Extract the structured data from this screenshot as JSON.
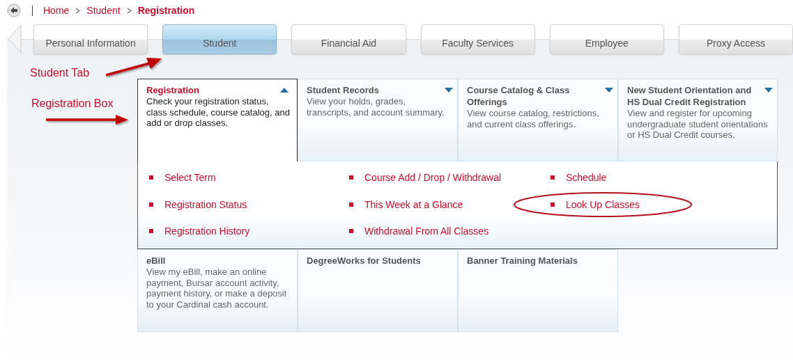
{
  "breadcrumb": [
    {
      "label": "Home",
      "current": false
    },
    {
      "label": "Student",
      "current": false
    },
    {
      "label": "Registration",
      "current": true
    }
  ],
  "tabs": [
    {
      "label": "Personal Information",
      "selected": false
    },
    {
      "label": "Student",
      "selected": true
    },
    {
      "label": "Financial Aid",
      "selected": false
    },
    {
      "label": "Faculty Services",
      "selected": false
    },
    {
      "label": "Employee",
      "selected": false
    },
    {
      "label": "Proxy Access",
      "selected": false
    }
  ],
  "annotations": [
    {
      "text": "Student Tab",
      "kind": "tab"
    },
    {
      "text": "Registration Box",
      "kind": "box"
    }
  ],
  "cards": [
    {
      "title": "Registration",
      "description": "Check your registration status, class schedule, course catalog, and add or drop classes.",
      "expanded": true
    },
    {
      "title": "Student Records",
      "description": "View your holds, grades, transcripts, and account summary.",
      "expanded": false
    },
    {
      "title": "Course Catalog & Class Offerings",
      "description": "View course catalog, restrictions, and current class offerings.",
      "expanded": false
    },
    {
      "title": "New Student Orientation and HS Dual Credit Registration",
      "description": "View and register for upcoming undergraduate student orientations or HS Dual Credit courses.",
      "expanded": false
    },
    {
      "title": "eBill",
      "description": "View my eBill, make an online payment, Bursar account activity, payment history, or make a deposit to your Cardinal cash account."
    },
    {
      "title": "DegreeWorks for Students"
    },
    {
      "title": "Banner Training Materials"
    }
  ],
  "menu": [
    {
      "label": "Select Term",
      "circled": false
    },
    {
      "label": "Course Add / Drop / Withdrawal",
      "circled": false
    },
    {
      "label": "Schedule",
      "circled": false
    },
    {
      "label": "Registration Status",
      "circled": false
    },
    {
      "label": "This Week at a Glance",
      "circled": false
    },
    {
      "label": "Look Up Classes",
      "circled": true
    },
    {
      "label": "Registration History",
      "circled": false
    },
    {
      "label": "Withdrawal From All Classes",
      "circled": false
    }
  ]
}
